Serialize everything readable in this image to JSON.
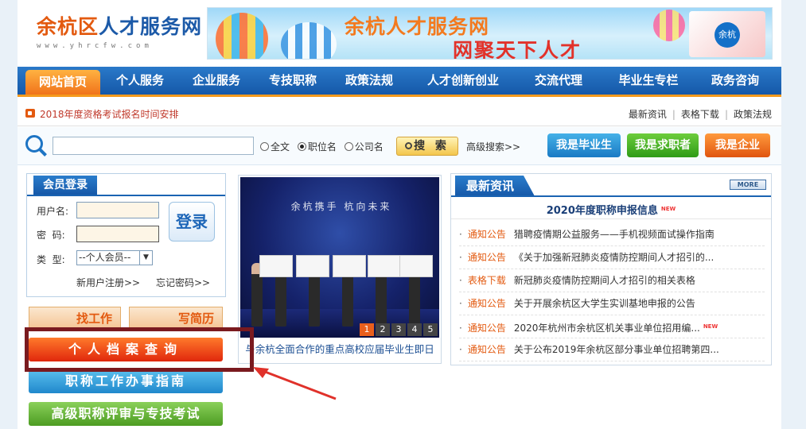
{
  "logo": {
    "title_part1": "余杭区",
    "title_part2": "人才服务网",
    "subtitle": "www.yhrcfw.com"
  },
  "banner": {
    "line1": "余杭人才服务网",
    "line2": "网聚天下人才",
    "badge": "余杭"
  },
  "nav": {
    "home": "网站首页",
    "items": [
      "个人服务",
      "企业服务",
      "专技职称",
      "政策法规",
      "人才创新创业",
      "交流代理",
      "毕业生专栏",
      "政务咨询"
    ]
  },
  "notice": {
    "text": "2018年度资格考试报名时间安排"
  },
  "quicklinks": [
    "最新资讯",
    "表格下载",
    "政策法规"
  ],
  "search": {
    "value": "",
    "radios": [
      {
        "label": "全文",
        "checked": false
      },
      {
        "label": "职位名",
        "checked": true
      },
      {
        "label": "公司名",
        "checked": false
      }
    ],
    "button": "搜 索",
    "advanced": "高级搜索>>"
  },
  "roles": [
    "我是毕业生",
    "我是求职者",
    "我是企业"
  ],
  "login": {
    "title": "会员登录",
    "username_label": "用户名:",
    "password_label": "密  码:",
    "type_label": "类  型:",
    "type_value": "--个人会员--",
    "submit": "登录",
    "register": "新用户注册>>",
    "forgot": "忘记密码>>"
  },
  "side": {
    "job": "找工作",
    "resume": "写简历",
    "archive": "个人档案查询",
    "title_guide": "职称工作办事指南",
    "senior": "高级职称评审与专技考试"
  },
  "slideshow": {
    "screen_text": "余杭携手 杭向未来",
    "pages": [
      "1",
      "2",
      "3",
      "4",
      "5"
    ],
    "active_page": 0,
    "caption": "与余杭全面合作的重点高校应届毕业生即日"
  },
  "news": {
    "title": "最新资讯",
    "more": "MORE",
    "new_badge": "NEW",
    "feature": "2020年度职称申报信息",
    "items": [
      {
        "cat": "通知公告",
        "title": "猎聘疫情期公益服务——手机视频面试操作指南",
        "new": false
      },
      {
        "cat": "通知公告",
        "title": "《关于加强新冠肺炎疫情防控期间人才招引的...",
        "new": false
      },
      {
        "cat": "表格下载",
        "title": "新冠肺炎疫情防控期间人才招引的相关表格",
        "new": false
      },
      {
        "cat": "通知公告",
        "title": "关于开展余杭区大学生实训基地申报的公告",
        "new": false
      },
      {
        "cat": "通知公告",
        "title": "2020年杭州市余杭区机关事业单位招用编...",
        "new": true
      },
      {
        "cat": "通知公告",
        "title": "关于公布2019年余杭区部分事业单位招聘第四...",
        "new": false
      }
    ]
  },
  "colors": {
    "brand_blue": "#1658a8",
    "accent_orange": "#f0731b",
    "highlight": "#7a1a1f"
  }
}
